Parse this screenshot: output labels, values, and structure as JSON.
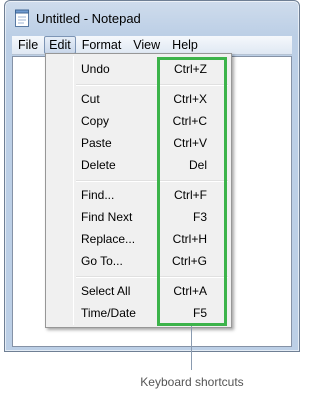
{
  "window": {
    "title": "Untitled - Notepad"
  },
  "menubar": {
    "items": [
      {
        "label": "File"
      },
      {
        "label": "Edit",
        "active": true
      },
      {
        "label": "Format"
      },
      {
        "label": "View"
      },
      {
        "label": "Help"
      }
    ]
  },
  "edit_menu": {
    "groups": [
      [
        {
          "label": "Undo",
          "shortcut": "Ctrl+Z"
        }
      ],
      [
        {
          "label": "Cut",
          "shortcut": "Ctrl+X"
        },
        {
          "label": "Copy",
          "shortcut": "Ctrl+C"
        },
        {
          "label": "Paste",
          "shortcut": "Ctrl+V"
        },
        {
          "label": "Delete",
          "shortcut": "Del"
        }
      ],
      [
        {
          "label": "Find...",
          "shortcut": "Ctrl+F"
        },
        {
          "label": "Find Next",
          "shortcut": "F3"
        },
        {
          "label": "Replace...",
          "shortcut": "Ctrl+H"
        },
        {
          "label": "Go To...",
          "shortcut": "Ctrl+G"
        }
      ],
      [
        {
          "label": "Select All",
          "shortcut": "Ctrl+A"
        },
        {
          "label": "Time/Date",
          "shortcut": "F5"
        }
      ]
    ]
  },
  "callout": {
    "label": "Keyboard shortcuts",
    "highlight_color": "#3cb34a"
  }
}
